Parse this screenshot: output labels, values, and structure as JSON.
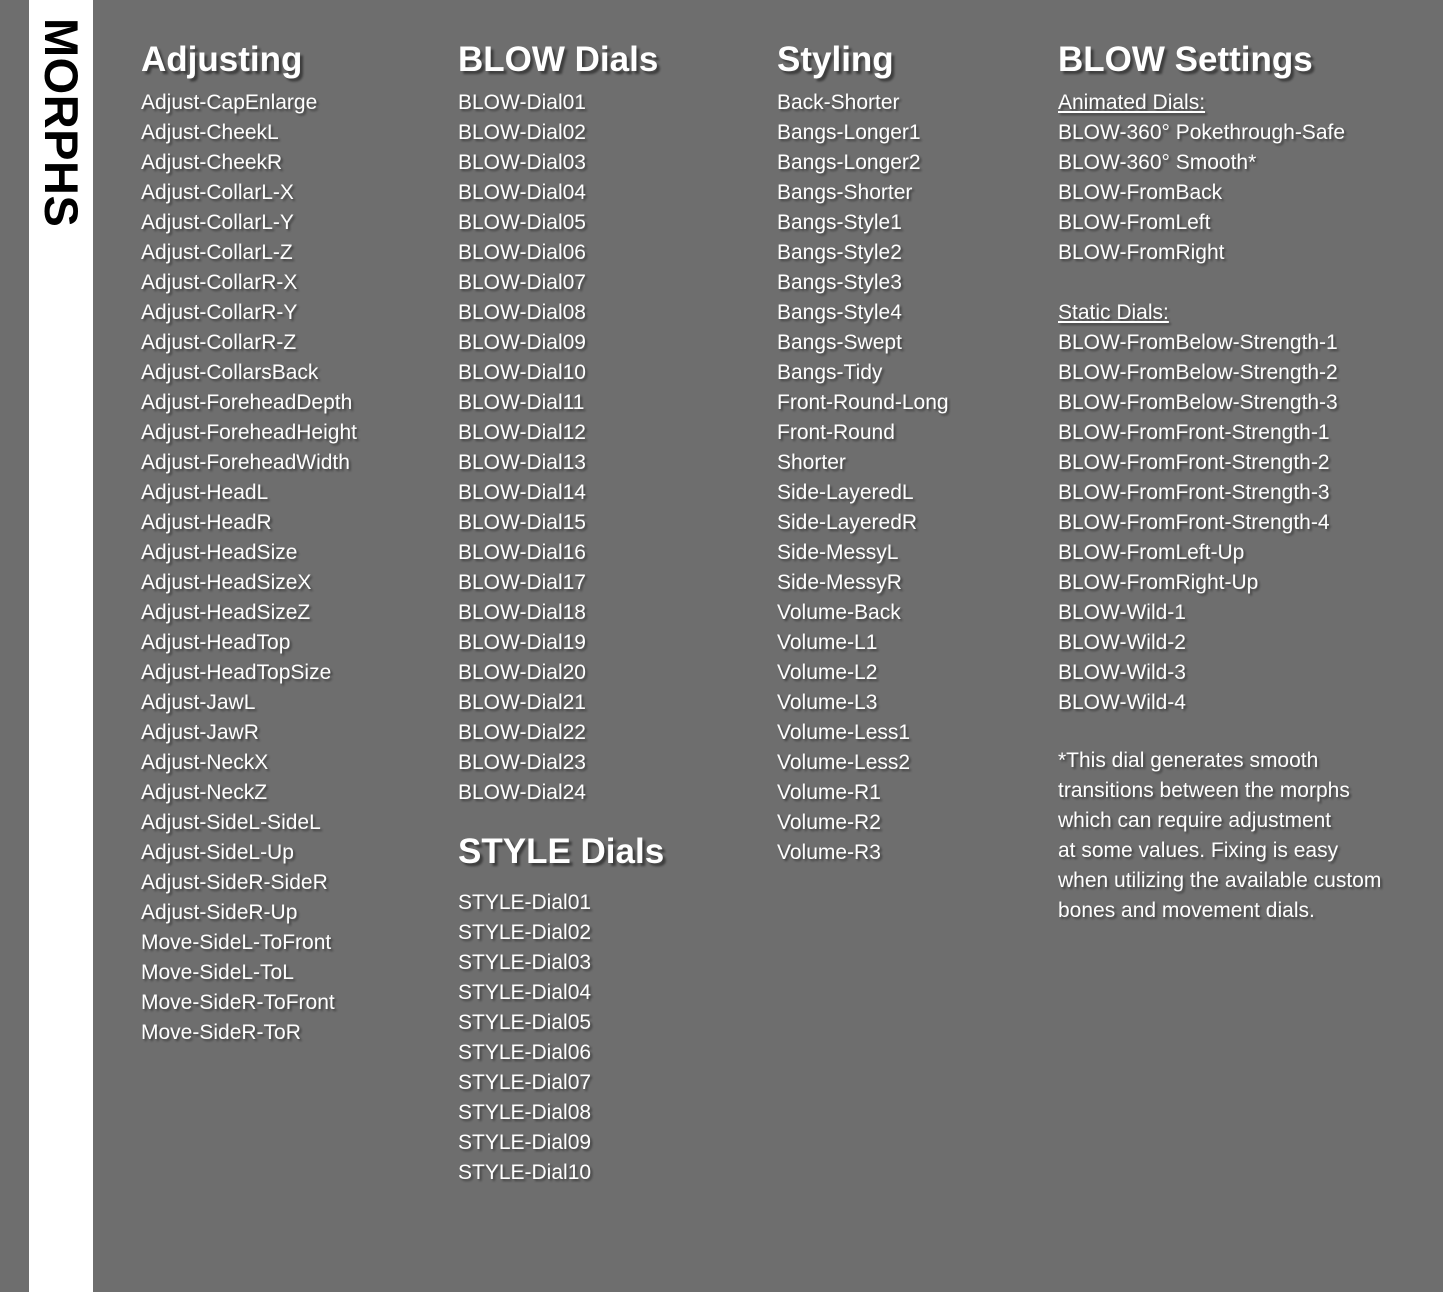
{
  "spine": {
    "label": "MORPHS"
  },
  "columns": [
    {
      "title": "Adjusting",
      "items": [
        "Adjust-CapEnlarge",
        "Adjust-CheekL",
        "Adjust-CheekR",
        "Adjust-CollarL-X",
        "Adjust-CollarL-Y",
        "Adjust-CollarL-Z",
        "Adjust-CollarR-X",
        "Adjust-CollarR-Y",
        "Adjust-CollarR-Z",
        "Adjust-CollarsBack",
        "Adjust-ForeheadDepth",
        "Adjust-ForeheadHeight",
        "Adjust-ForeheadWidth",
        "Adjust-HeadL",
        "Adjust-HeadR",
        "Adjust-HeadSize",
        "Adjust-HeadSizeX",
        "Adjust-HeadSizeZ",
        "Adjust-HeadTop",
        "Adjust-HeadTopSize",
        "Adjust-JawL",
        "Adjust-JawR",
        "Adjust-NeckX",
        "Adjust-NeckZ",
        "Adjust-SideL-SideL",
        "Adjust-SideL-Up",
        "Adjust-SideR-SideR",
        "Adjust-SideR-Up",
        "Move-SideL-ToFront",
        "Move-SideL-ToL",
        "Move-SideR-ToFront",
        "Move-SideR-ToR"
      ]
    },
    {
      "title": "BLOW Dials",
      "items": [
        "BLOW-Dial01",
        "BLOW-Dial02",
        "BLOW-Dial03",
        "BLOW-Dial04",
        "BLOW-Dial05",
        "BLOW-Dial06",
        "BLOW-Dial07",
        "BLOW-Dial08",
        "BLOW-Dial09",
        "BLOW-Dial10",
        "BLOW-Dial11",
        "BLOW-Dial12",
        "BLOW-Dial13",
        "BLOW-Dial14",
        "BLOW-Dial15",
        "BLOW-Dial16",
        "BLOW-Dial17",
        "BLOW-Dial18",
        "BLOW-Dial19",
        "BLOW-Dial20",
        "BLOW-Dial21",
        "BLOW-Dial22",
        "BLOW-Dial23",
        "BLOW-Dial24"
      ],
      "section_title": "STYLE Dials",
      "section_items": [
        "STYLE-Dial01",
        "STYLE-Dial02",
        "STYLE-Dial03",
        "STYLE-Dial04",
        "STYLE-Dial05",
        "STYLE-Dial06",
        "STYLE-Dial07",
        "STYLE-Dial08",
        "STYLE-Dial09",
        "STYLE-Dial10"
      ]
    },
    {
      "title": "Styling",
      "items": [
        "Back-Shorter",
        "Bangs-Longer1",
        "Bangs-Longer2",
        "Bangs-Shorter",
        "Bangs-Style1",
        "Bangs-Style2",
        "Bangs-Style3",
        "Bangs-Style4",
        "Bangs-Swept",
        "Bangs-Tidy",
        "Front-Round-Long",
        "Front-Round",
        "Shorter",
        "Side-LayeredL",
        "Side-LayeredR",
        "Side-MessyL",
        "Side-MessyR",
        "Volume-Back",
        "Volume-L1",
        "Volume-L2",
        "Volume-L3",
        "Volume-Less1",
        "Volume-Less2",
        "Volume-R1",
        "Volume-R2",
        "Volume-R3"
      ]
    },
    {
      "title": "BLOW Settings",
      "groups": [
        {
          "heading": "Animated Dials:",
          "items": [
            "BLOW-360° Pokethrough-Safe",
            "BLOW-360° Smooth*",
            "BLOW-FromBack",
            "BLOW-FromLeft",
            "BLOW-FromRight"
          ]
        },
        {
          "heading": "Static Dials:",
          "items": [
            "BLOW-FromBelow-Strength-1",
            "BLOW-FromBelow-Strength-2",
            "BLOW-FromBelow-Strength-3",
            "BLOW-FromFront-Strength-1",
            "BLOW-FromFront-Strength-2",
            "BLOW-FromFront-Strength-3",
            "BLOW-FromFront-Strength-4",
            "BLOW-FromLeft-Up",
            "BLOW-FromRight-Up",
            "BLOW-Wild-1",
            "BLOW-Wild-2",
            "BLOW-Wild-3",
            "BLOW-Wild-4"
          ]
        }
      ],
      "note_lines": [
        "*This dial generates smooth",
        "transitions between the morphs",
        "which can require adjustment",
        "at some values. Fixing is easy",
        "when utilizing the available custom",
        "bones and movement dials."
      ]
    }
  ],
  "colors": {
    "background": "#6e6e6e",
    "spine": "#ffffff",
    "text": "#ffffff",
    "spine_text": "#000000"
  }
}
